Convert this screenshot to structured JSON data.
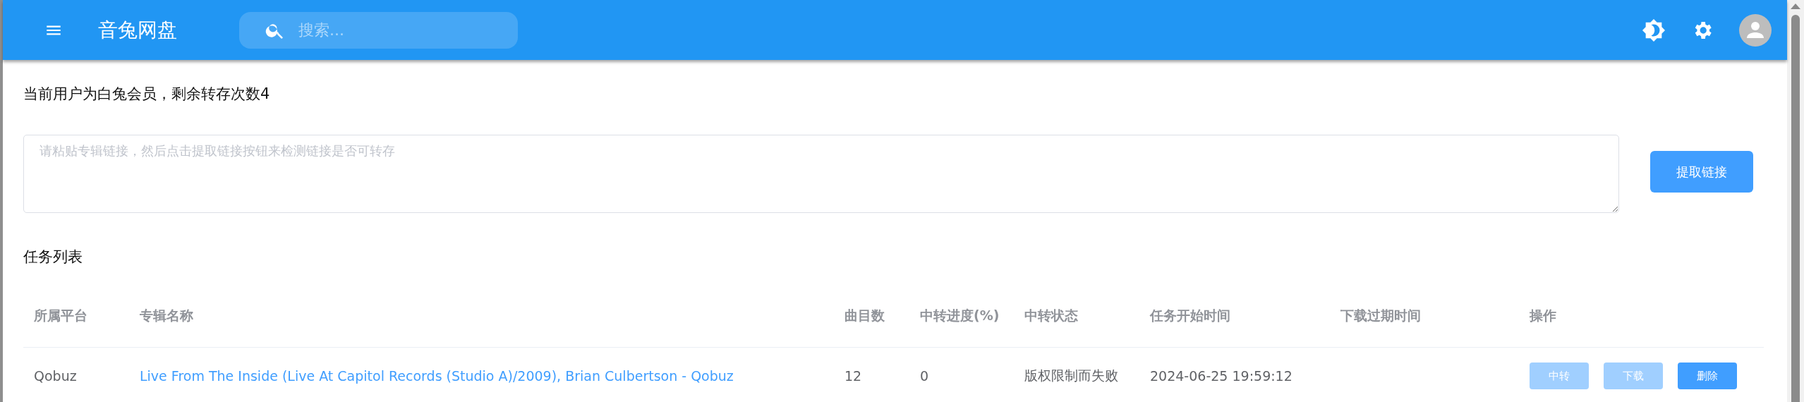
{
  "app_bar": {
    "title": "音兔网盘",
    "search": {
      "placeholder": "搜索..."
    }
  },
  "user_status": "当前用户为白兔会员，剩余转存次数4",
  "link_input": {
    "placeholder": "请粘贴专辑链接，然后点击提取链接按钮来检测链接是否可转存"
  },
  "extract_button": "提取链接",
  "task_list": {
    "title": "任务列表",
    "columns": [
      "所属平台",
      "专辑名称",
      "曲目数",
      "中转进度(%)",
      "中转状态",
      "任务开始时间",
      "下载过期时间",
      "操作"
    ],
    "rows": [
      {
        "platform": "Qobuz",
        "album": "Live From The Inside (Live At Capitol Records (Studio A)/2009), Brian Culbertson - Qobuz",
        "tracks": "12",
        "progress": "0",
        "status": "版权限制而失败",
        "start_time": "2024-06-25 19:59:12",
        "actions": [
          {
            "label": "中转",
            "disabled": true
          },
          {
            "label": "下载",
            "disabled": true
          },
          {
            "label": "删除",
            "disabled": false
          }
        ]
      }
    ]
  }
}
